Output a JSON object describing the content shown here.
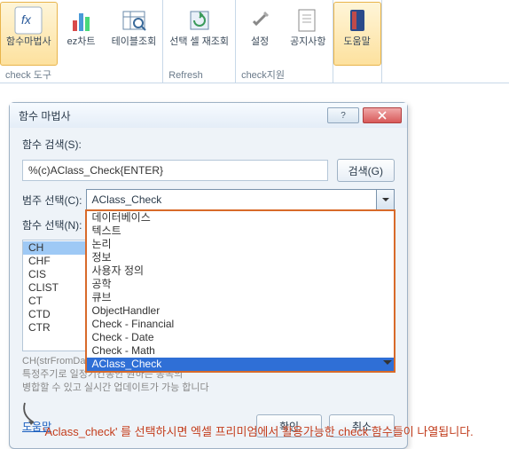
{
  "ribbon": {
    "groups": [
      {
        "label": "check 도구",
        "buttons": [
          {
            "name": "함수마법사",
            "label": "함수마법사",
            "active": true
          },
          {
            "name": "ez차트",
            "label": "ez차트"
          },
          {
            "name": "테이블조회",
            "label": "테이블조회"
          }
        ]
      },
      {
        "label": "Refresh",
        "buttons": [
          {
            "name": "선택셀재조회",
            "label": "선택 셀\n재조회"
          }
        ]
      },
      {
        "label": "check지원",
        "buttons": [
          {
            "name": "설정",
            "label": "설정"
          },
          {
            "name": "공지사항",
            "label": "공지사항"
          }
        ]
      },
      {
        "label": "",
        "buttons": [
          {
            "name": "도움말",
            "label": "도움말",
            "active": true
          }
        ]
      }
    ]
  },
  "dialog": {
    "title": "함수 마법사",
    "search_label": "함수 검색(S):",
    "search_u": "S",
    "search_value": "%(c)AClass_Check{ENTER}",
    "search_btn": "검색(G)",
    "search_btn_u": "G",
    "cat_label": "범주 선택(C):",
    "cat_u": "C",
    "cat_value": "AClass_Check",
    "cat_options": [
      "데이터베이스",
      "텍스트",
      "논리",
      "정보",
      "사용자 정의",
      "공학",
      "큐브",
      "ObjectHandler",
      "Check - Financial",
      "Check - Date",
      "Check - Math",
      "AClass_Check"
    ],
    "cat_selected_index": 11,
    "func_label": "함수 선택(N):",
    "func_u": "N",
    "func_list": [
      "CH",
      "CHF",
      "CIS",
      "CLIST",
      "CT",
      "CTD",
      "CTR"
    ],
    "func_selected_index": 0,
    "hint1": "CH(strFromDate ...                                                ubjects_p,...)",
    "hint2": "특정주기로 일정기간동안 원하는 종목의",
    "hint3": "병합할 수 있고 실시간 업데이트가 가능 합니다",
    "help": "도움말",
    "ok": "확인",
    "cancel": "취소"
  },
  "annotation": "'Aclass_check' 를 선택하시면 엑셀 프리미엄에서 활용가능한 check 함수들이 나열됩니다."
}
